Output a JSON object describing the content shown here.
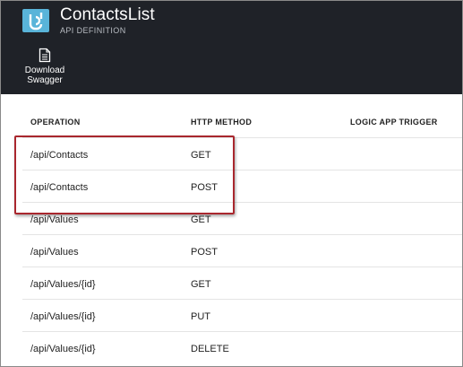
{
  "header": {
    "title": "ContactsList",
    "subtitle": "API DEFINITION"
  },
  "toolbar": {
    "download_label_line1": "Download",
    "download_label_line2": "Swagger"
  },
  "table": {
    "columns": {
      "operation": "OPERATION",
      "http_method": "HTTP METHOD",
      "logic_app_trigger": "LOGIC APP TRIGGER"
    },
    "rows": [
      {
        "operation": "/api/Contacts",
        "method": "GET"
      },
      {
        "operation": "/api/Contacts",
        "method": "POST"
      },
      {
        "operation": "/api/Values",
        "method": "GET"
      },
      {
        "operation": "/api/Values",
        "method": "POST"
      },
      {
        "operation": "/api/Values/{id}",
        "method": "GET"
      },
      {
        "operation": "/api/Values/{id}",
        "method": "PUT"
      },
      {
        "operation": "/api/Values/{id}",
        "method": "DELETE"
      }
    ]
  },
  "colors": {
    "header_bg": "#1f2228",
    "accent": "#59b4d9",
    "highlight_border": "#a9272e"
  }
}
